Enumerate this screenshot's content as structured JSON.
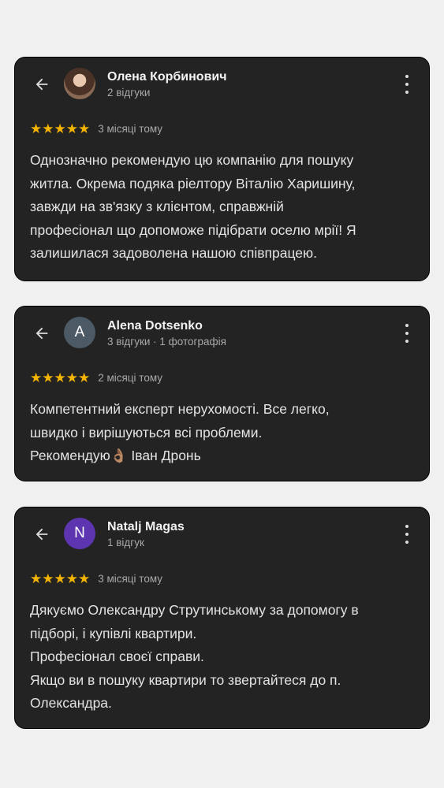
{
  "reviews": [
    {
      "name": "Олена Корбинович",
      "meta": "2 відгуки",
      "avatar": {
        "type": "photo",
        "letter": ""
      },
      "stars": "★★★★★",
      "rating": 5,
      "time": "3 місяці тому",
      "text": "Однозначно рекомендую цю компанію для пошуку\nжитла. Окрема подяка ріелтору Віталію Харишину,\nзавжди на зв'язку з клієнтом, справжній\nпрофесіонал що допоможе підібрати оселю мрії! Я\nзалишилася задоволена нашою співпрацею."
    },
    {
      "name": "Alena Dotsenko",
      "meta": "3 відгуки · 1 фотографія",
      "avatar": {
        "type": "letter",
        "letter": "A",
        "color": "#4c5a66"
      },
      "stars": "★★★★★",
      "rating": 5,
      "time": "2 місяці тому",
      "text": "Компетентний експерт нерухомості. Все легко,\nшвидко і вирішуються всі проблеми.\nРекомендую👌🏽 Іван Дронь"
    },
    {
      "name": "Natalj Magas",
      "meta": "1 відгук",
      "avatar": {
        "type": "letter",
        "letter": "N",
        "color": "#5e35b1"
      },
      "stars": "★★★★★",
      "rating": 5,
      "time": "3 місяці тому",
      "text": "Дякуємо Олександру Струтинському за допомогу в\nпідборі, і купівлі квартири.\nПрофесіонал своєї справи.\nЯкщо ви в пошуку квартири то звертайтеся до п.\nОлександра."
    }
  ],
  "icons": {
    "back": "arrow-back-icon",
    "more": "more-vert-icon",
    "star": "star-icon"
  },
  "colors": {
    "card_bg": "#232323",
    "page_bg": "#f0f0f0",
    "star": "#f4b400"
  }
}
